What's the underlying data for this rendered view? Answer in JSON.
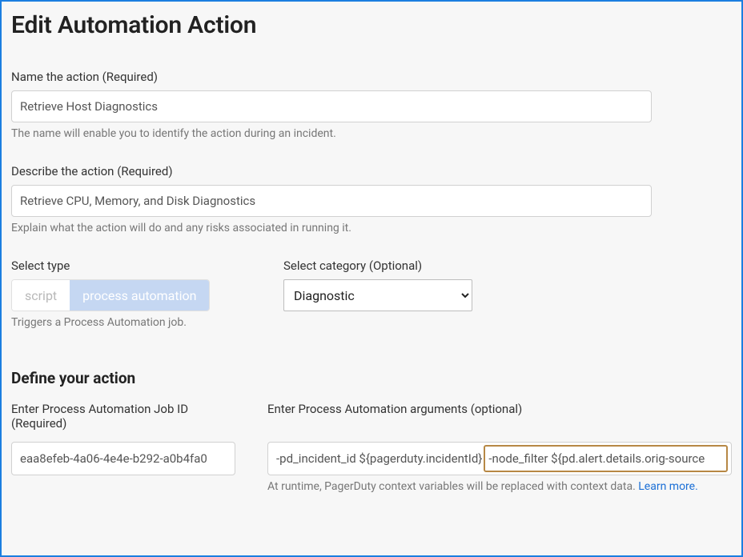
{
  "page_title": "Edit Automation Action",
  "name_field": {
    "label": "Name the action (Required)",
    "value": "Retrieve Host Diagnostics",
    "help": "The name will enable you to identify the action during an incident."
  },
  "describe_field": {
    "label": "Describe the action (Required)",
    "value": "Retrieve CPU, Memory, and Disk Diagnostics",
    "help": "Explain what the action will do and any risks associated in running it."
  },
  "type_field": {
    "label": "Select type",
    "options": {
      "script": "script",
      "process_automation": "process automation"
    },
    "help": "Triggers a Process Automation job."
  },
  "category_field": {
    "label": "Select category (Optional)",
    "selected": "Diagnostic"
  },
  "define_heading": "Define your action",
  "jobid_field": {
    "label": "Enter Process Automation Job ID (Required)",
    "value": "eaa8efeb-4a06-4e4e-b292-a0b4fa0"
  },
  "args_field": {
    "label": "Enter Process Automation arguments (optional)",
    "value_left": "-pd_incident_id ${pagerduty.incidentId}",
    "value_highlight": "-node_filter ${pd.alert.details.orig-source",
    "runtime_help": "At runtime, PagerDuty context variables will be replaced with context data. ",
    "learn_more": "Learn more."
  }
}
